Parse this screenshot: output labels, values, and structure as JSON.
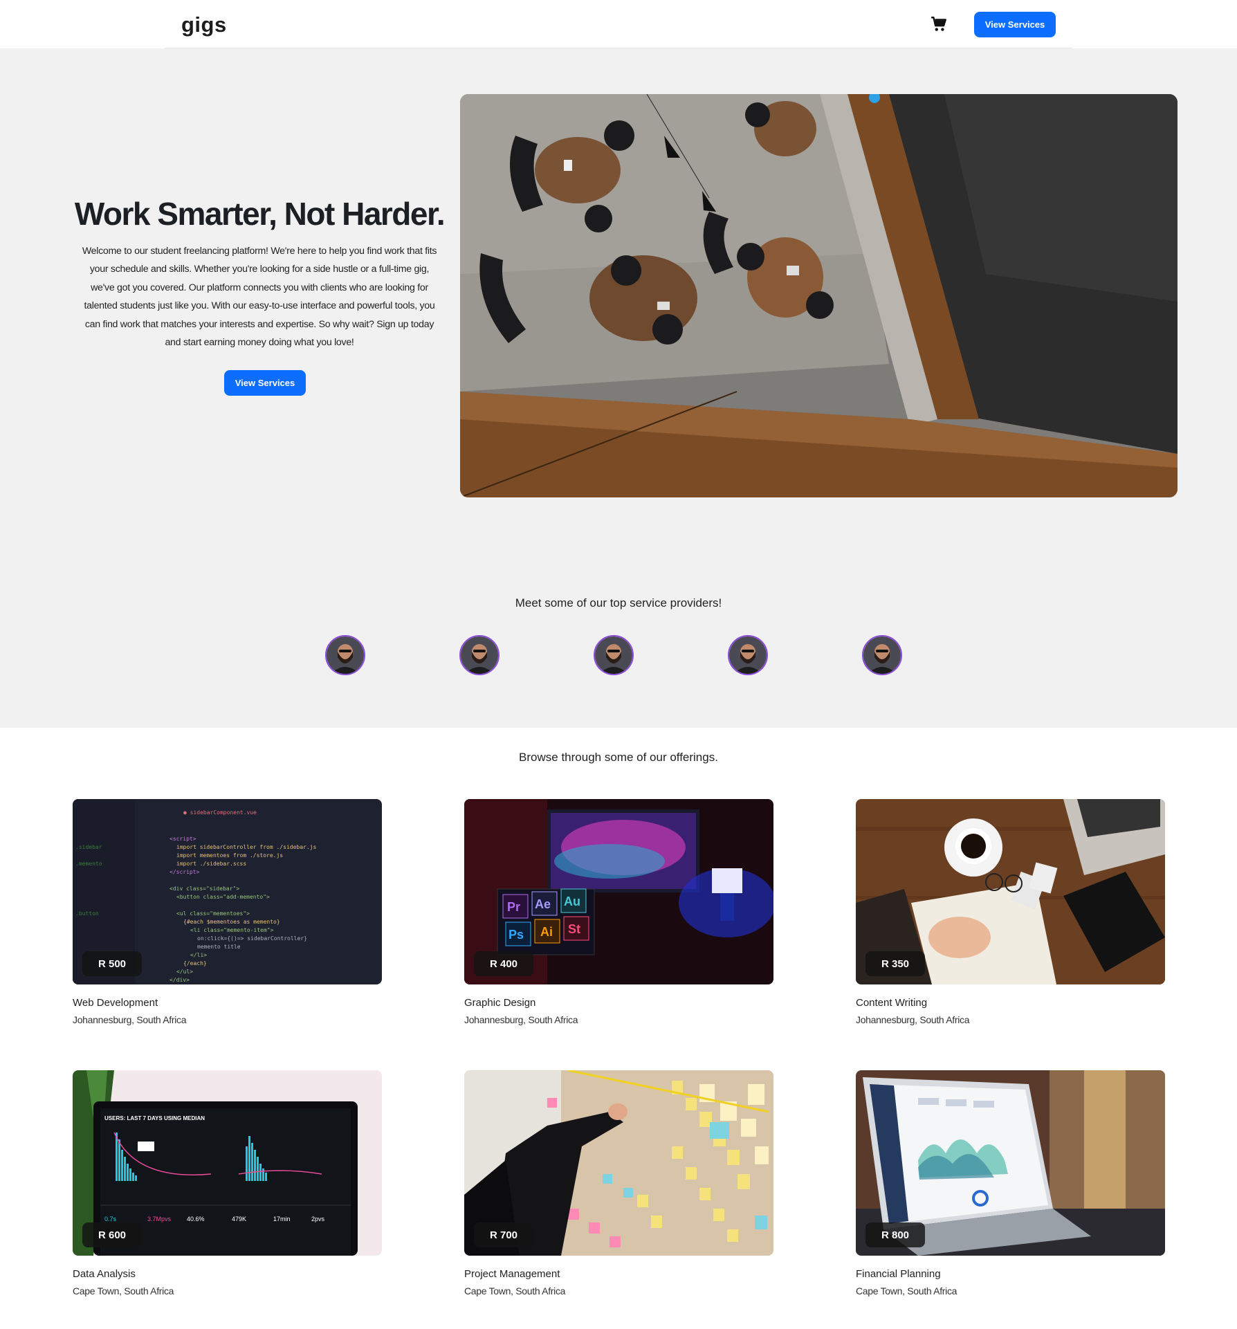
{
  "navbar": {
    "brand": "gigs",
    "cart_icon": "cart-icon",
    "button_label": "View Services"
  },
  "hero": {
    "title": "Work Smarter, Not Harder.",
    "text": "Welcome to our student freelancing platform! We're here to help you find work that fits your schedule and skills. Whether you're looking for a side hustle or a full-time gig, we've got you covered. Our platform connects you with clients who are looking for talented students just like you. With our easy-to-use interface and powerful tools, you can find work that matches your interests and expertise. So why wait? Sign up today and start earning money doing what you love!",
    "button_label": "View Services"
  },
  "providers": {
    "title": "Meet some of our top service providers!",
    "count": 5
  },
  "offerings": {
    "title": "Browse through some of our offerings.",
    "cards": [
      {
        "price": "R 500",
        "title": "Web Development",
        "location": "Johannesburg, South Africa"
      },
      {
        "price": "R 400",
        "title": "Graphic Design",
        "location": "Johannesburg, South Africa"
      },
      {
        "price": "R 350",
        "title": "Content Writing",
        "location": "Johannesburg, South Africa"
      },
      {
        "price": "R 600",
        "title": "Data Analysis",
        "location": "Cape Town, South Africa"
      },
      {
        "price": "R 700",
        "title": "Project Management",
        "location": "Cape Town, South Africa"
      },
      {
        "price": "R 800",
        "title": "Financial Planning",
        "location": "Cape Town, South Africa"
      }
    ]
  },
  "colors": {
    "primary": "#0d6efd",
    "avatar_ring": "#8a4cd9",
    "page_bg": "#f1f1f1"
  }
}
